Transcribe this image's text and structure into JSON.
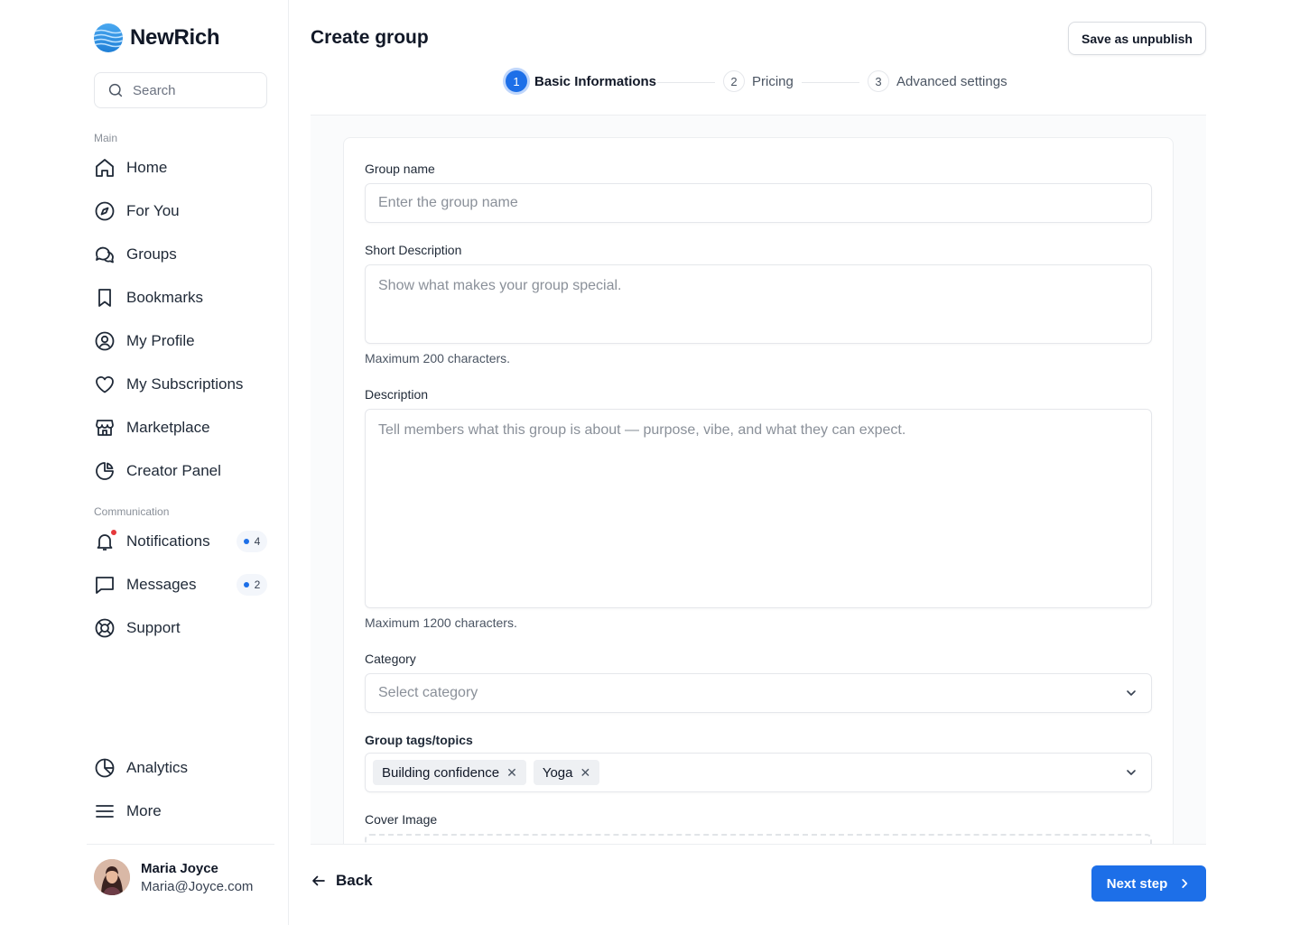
{
  "app": {
    "name": "NewRich"
  },
  "search": {
    "placeholder": "Search"
  },
  "sidebar": {
    "main_label": "Main",
    "main_items": [
      {
        "label": "Home",
        "icon": "home-icon"
      },
      {
        "label": "For You",
        "icon": "compass-icon"
      },
      {
        "label": "Groups",
        "icon": "chat-bubbles-icon"
      },
      {
        "label": "Bookmarks",
        "icon": "bookmark-icon"
      },
      {
        "label": "My Profile",
        "icon": "user-circle-icon"
      },
      {
        "label": "My Subscriptions",
        "icon": "heart-icon"
      },
      {
        "label": "Marketplace",
        "icon": "storefront-icon"
      },
      {
        "label": "Creator Panel",
        "icon": "pie-chart-icon"
      }
    ],
    "communication_label": "Communication",
    "communication_items": [
      {
        "label": "Notifications",
        "icon": "bell-icon",
        "count": "4"
      },
      {
        "label": "Messages",
        "icon": "message-icon",
        "count": "2"
      },
      {
        "label": "Support",
        "icon": "lifebuoy-icon"
      }
    ],
    "bottom_items": [
      {
        "label": "Analytics",
        "icon": "analytics-icon"
      },
      {
        "label": "More",
        "icon": "menu-icon"
      }
    ]
  },
  "user": {
    "name": "Maria Joyce",
    "email": "Maria@Joyce.com"
  },
  "header": {
    "title": "Create group",
    "save_unpublish": "Save as unpublish"
  },
  "steps": [
    {
      "number": "1",
      "label": "Basic Informations",
      "active": true
    },
    {
      "number": "2",
      "label": "Pricing",
      "active": false
    },
    {
      "number": "3",
      "label": "Advanced settings",
      "active": false
    }
  ],
  "form": {
    "group_name": {
      "label": "Group name",
      "placeholder": "Enter the group name"
    },
    "short_description": {
      "label": "Short Description",
      "placeholder": "Show what makes your group special.",
      "help": "Maximum 200 characters."
    },
    "description": {
      "label": "Description",
      "placeholder": "Tell members what this group is about — purpose, vibe, and what they can expect.",
      "help": "Maximum 1200 characters."
    },
    "category": {
      "label": "Category",
      "placeholder": "Select category"
    },
    "tags": {
      "label": "Group tags/topics",
      "items": [
        "Building confidence",
        "Yoga"
      ]
    },
    "cover_image": {
      "label": "Cover Image"
    }
  },
  "footer": {
    "back": "Back",
    "next": "Next step"
  },
  "colors": {
    "accent": "#1d6fe8",
    "notification_dot": "#e5383b"
  }
}
